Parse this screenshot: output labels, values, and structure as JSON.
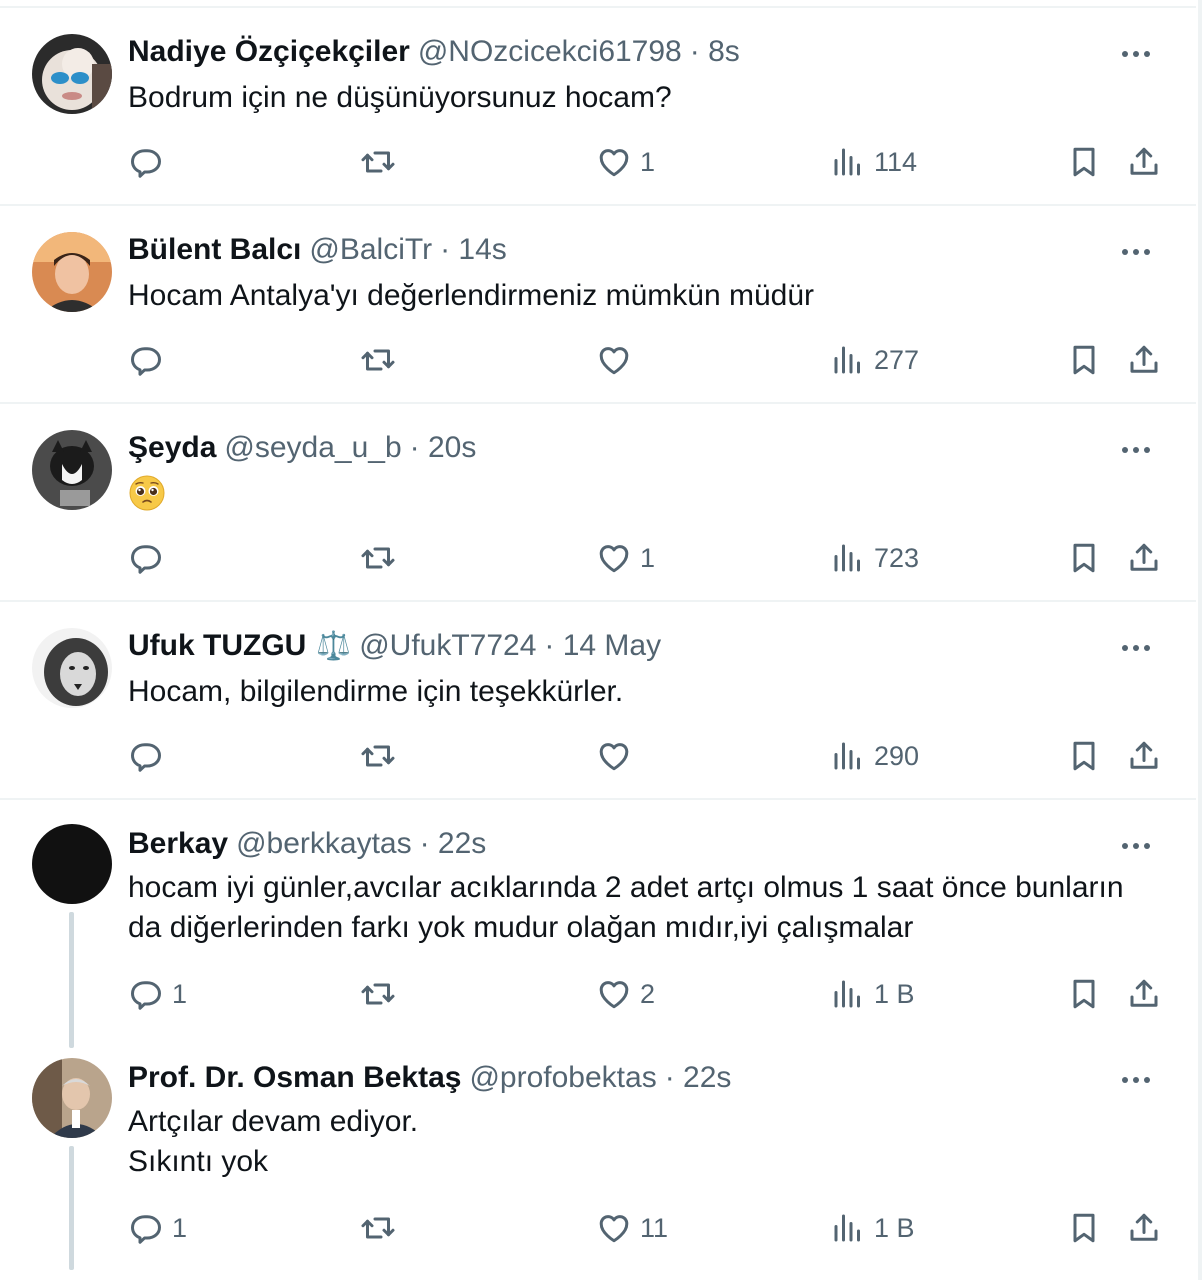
{
  "tweets": [
    {
      "name": "Nadiye Özçiçekçiler",
      "handle": "@NOzcicekci61798",
      "time": "· 8s",
      "text": [
        "Bodrum için ne düşünüyorsunuz hocam?"
      ],
      "replies": "",
      "likes": "1",
      "views": "114",
      "avatar": "avatar-nadiye"
    },
    {
      "name": "Bülent Balcı",
      "handle": "@BalciTr",
      "time": "· 14s",
      "text": [
        "Hocam Antalya'yı değerlendirmeniz mümkün müdür"
      ],
      "replies": "",
      "likes": "",
      "views": "277",
      "avatar": "avatar-bulent"
    },
    {
      "name": "Şeyda",
      "handle": "@seyda_u_b",
      "time": "· 20s",
      "text": [],
      "emoji": "pleading-face-emoji",
      "replies": "",
      "likes": "1",
      "views": "723",
      "avatar": "avatar-seyda"
    },
    {
      "name": "Ufuk TUZGU",
      "badge": "⚖️",
      "handle": "@UfukT7724",
      "time": "· 14 May",
      "text": [
        "Hocam, bilgilendirme için teşekkürler."
      ],
      "replies": "",
      "likes": "",
      "views": "290",
      "avatar": "avatar-ufuk"
    },
    {
      "name": "Berkay",
      "handle": "@berkkaytas",
      "time": "· 22s",
      "text": [
        "hocam iyi günler,avcılar acıklarında 2 adet artçı olmus 1 saat önce bunların",
        "da diğerlerinden farkı yok mudur olağan mıdır,iyi çalışmalar"
      ],
      "replies": "1",
      "likes": "2",
      "views": "1 B",
      "avatar": "avatar-berkay"
    },
    {
      "name": "Prof. Dr. Osman Bektaş",
      "handle": "@profobektas",
      "time": "· 22s",
      "text": [
        "Artçılar devam ediyor.",
        "Sıkıntı yok"
      ],
      "replies": "1",
      "likes": "11",
      "views": "1 B",
      "avatar": "avatar-osman"
    }
  ],
  "icons": {
    "reply": "reply-icon",
    "retweet": "retweet-icon",
    "like": "heart-icon",
    "views": "views-icon",
    "bookmark": "bookmark-icon",
    "share": "share-icon",
    "more": "more-icon"
  },
  "colors": {
    "text": "#0f1419",
    "secondary": "#536471",
    "border": "#eff3f4",
    "thread": "#cfd9de"
  }
}
